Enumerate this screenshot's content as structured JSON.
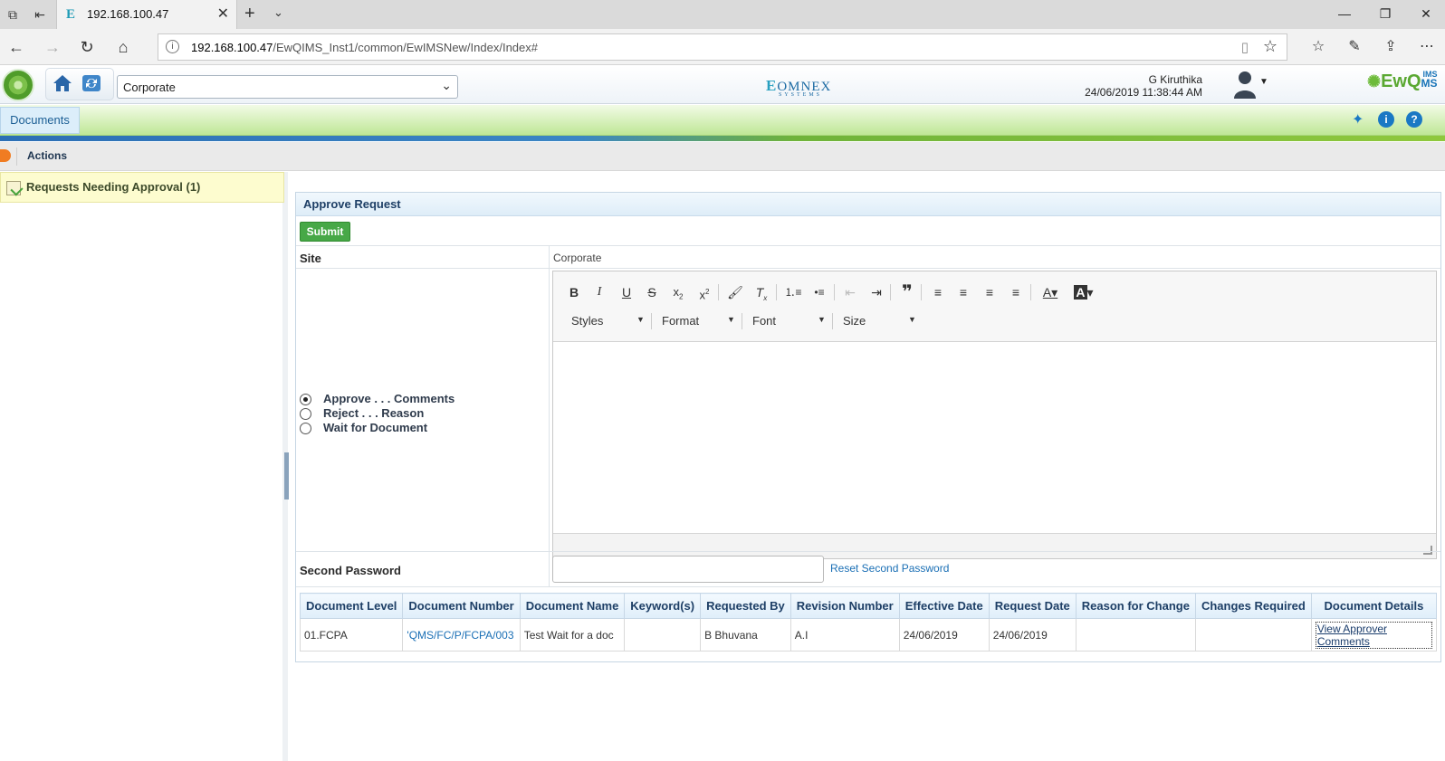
{
  "browser": {
    "tab_title": "192.168.100.47",
    "url_host": "192.168.100.47",
    "url_path": "/EwQIMS_Inst1/common/EwIMSNew/Index/Index#"
  },
  "header": {
    "site": "Corporate",
    "brand_center": "OMNEX",
    "brand_center_sub": "SYSTEMS",
    "user_name": "G Kiruthika",
    "user_time": "24/06/2019 11:38:44 AM",
    "product_name": "EwQ",
    "product_sup": "IMS",
    "product_suffix": "MS"
  },
  "nav": {
    "documents_tab": "Documents"
  },
  "actions": {
    "label": "Actions"
  },
  "left": {
    "request_item": "Requests Needing Approval (1)"
  },
  "form": {
    "title": "Approve Request",
    "submit_label": "Submit",
    "site_label": "Site",
    "site_value": "Corporate",
    "options": [
      {
        "label": "Approve . . . Comments",
        "selected": true
      },
      {
        "label": "Reject . . . Reason",
        "selected": false
      },
      {
        "label": "Wait for Document",
        "selected": false
      }
    ],
    "editor_combos": {
      "styles": "Styles",
      "format": "Format",
      "font": "Font",
      "size": "Size"
    },
    "second_password_label": "Second Password",
    "second_password_value": "",
    "reset_link": "Reset Second Password"
  },
  "table": {
    "headers": [
      "Document Level",
      "Document Number",
      "Document Name",
      "Keyword(s)",
      "Requested By",
      "Revision Number",
      "Effective Date",
      "Request Date",
      "Reason for Change",
      "Changes Required",
      "Document Details"
    ],
    "rows": [
      {
        "level": "01.FCPA",
        "number": "'QMS/FC/P/FCPA/003",
        "name": "Test Wait for a doc",
        "keywords": "",
        "requested_by": "B Bhuvana",
        "revision": "A.I",
        "effective_date": "24/06/2019",
        "request_date": "24/06/2019",
        "reason": "",
        "changes": "",
        "details_link": "View Approver Comments"
      }
    ]
  },
  "colors": {
    "accent_blue": "#1a6fb5",
    "submit_green": "#47a847",
    "nav_green": "#bfe796",
    "actions_orange": "#f07c22"
  }
}
